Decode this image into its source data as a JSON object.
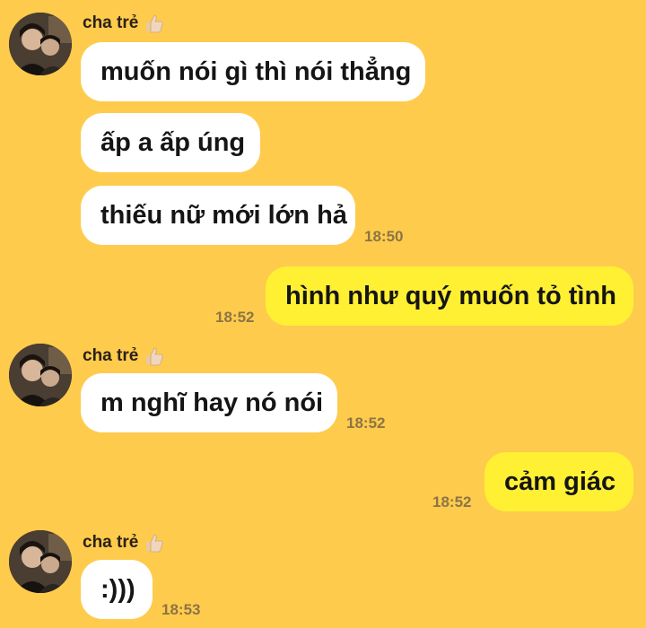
{
  "conversation": {
    "groups": [
      {
        "sender": {
          "name": "cha trẻ",
          "badge_icon": "thumbs-up-icon"
        },
        "messages": [
          "muốn nói gì thì nói thẳng",
          "ấp a ấp úng",
          "thiếu nữ mới lớn hả"
        ],
        "time": "18:50"
      },
      {
        "outgoing": true,
        "messages": [
          "hình như quý muốn tỏ tình"
        ],
        "time": "18:52"
      },
      {
        "sender": {
          "name": "cha trẻ",
          "badge_icon": "thumbs-up-icon"
        },
        "messages": [
          "m nghĩ hay nó nói"
        ],
        "time": "18:52"
      },
      {
        "outgoing": true,
        "messages": [
          "cảm giác"
        ],
        "time": "18:52"
      },
      {
        "sender": {
          "name": "cha trẻ",
          "badge_icon": "thumbs-up-icon"
        },
        "messages": [
          ":)))"
        ],
        "time": "18:53"
      }
    ]
  },
  "colors": {
    "background": "#FECB4C",
    "incoming_bubble": "#FFFFFF",
    "outgoing_bubble": "#FFF033",
    "timestamp": "#8C7446"
  }
}
